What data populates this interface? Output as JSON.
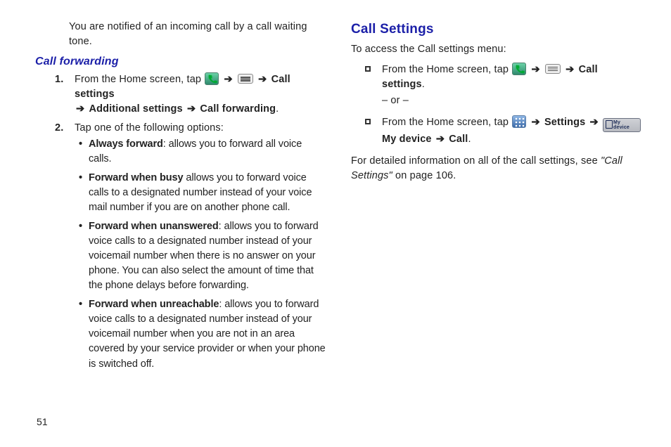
{
  "page_number": "51",
  "col1": {
    "intro": "You are notified of an incoming call by a call waiting tone.",
    "h3": "Call forwarding",
    "step1": {
      "num": "1.",
      "lead": "From the Home screen, tap ",
      "arrow": "➔",
      "s3": "Call settings",
      "s4": "Additional settings",
      "s5": "Call forwarding",
      "period": "."
    },
    "step2": {
      "num": "2.",
      "lead": "Tap one of the following options:"
    },
    "opts": {
      "a_bold": "Always forward",
      "a_rest": ": allows you to forward all voice calls.",
      "b_bold": "Forward when busy",
      "b_rest": " allows you to forward voice calls to a designated number instead of your voice mail number if you are on another phone call.",
      "c_bold": "Forward when unanswered",
      "c_rest": ": allows you to forward voice calls to a designated number instead of your voicemail number when there is no answer on your phone. You can also select the amount of time that the phone delays before forwarding.",
      "d_bold": "Forward when unreachable",
      "d_rest": ": allows you to forward voice calls to a designated number instead of your voicemail number when you are not in an area covered by your service provider or when your phone is switched off."
    }
  },
  "col2": {
    "h2": "Call Settings",
    "sub": "To access the Call settings menu:",
    "item1": {
      "lead": "From the Home screen, tap ",
      "arrow": "➔",
      "call_settings": "Call settings",
      "period": "."
    },
    "or": "– or –",
    "item2": {
      "lead": "From the Home screen, tap ",
      "arrow": "➔",
      "settings": "Settings",
      "mydevice_tab": "My device",
      "mydevice_bold": "My device",
      "call": "Call",
      "period": "."
    },
    "closing_a": "For detailed information on all of the call settings, see ",
    "closing_ref": "\"Call Settings\"",
    "closing_b": " on page 106."
  }
}
